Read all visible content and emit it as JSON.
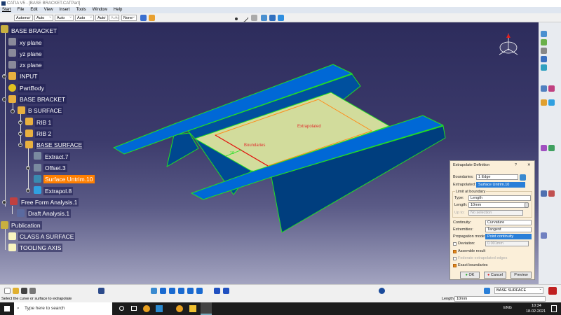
{
  "window": {
    "title": "CATIA V5 - [BASE BRACKET.CATPart]"
  },
  "menu": [
    "Start",
    "File",
    "Edit",
    "View",
    "Insert",
    "Tools",
    "Window",
    "Help"
  ],
  "toolbar_selects": [
    "Automa",
    "Auto",
    "Auto",
    "Auto",
    "Auto",
    "Auto",
    "None"
  ],
  "tree": {
    "root": "BASE BRACKET",
    "items": [
      "xy plane",
      "yz plane",
      "zx plane",
      "INPUT",
      "PartBody",
      "BASE BRACKET",
      "B SURFACE",
      "RIB 1",
      "RIB 2",
      "BASE SURFACE",
      "Extract.7",
      "Offset.3",
      "Surface Untrim.10",
      "Extrapol.8",
      "Free Form Analysis.1",
      "Draft Analysis.1",
      "Publication",
      "CLASS A SURFACE",
      "TOOLING AXIS"
    ],
    "selected": "Surface Untrim.10"
  },
  "model": {
    "labels": {
      "extrapolated": "Extrapolated",
      "boundaries": "Boundaries",
      "dimension": "10"
    },
    "colors": {
      "surface": "#0068d6",
      "edge": "#22e022",
      "plane": "#d2dc9c"
    }
  },
  "dialog": {
    "title": "Extrapolate Definition",
    "help": "?",
    "close": "✕",
    "boundaries_label": "Boundaries:",
    "boundaries_value": "1 Edge",
    "extrapolated_label": "Extrapolated:",
    "extrapolated_value": "Surface Untrim.10",
    "limit_group": "Limit at boundary",
    "type_label": "Type:",
    "type_value": "Length",
    "length_label": "Length:",
    "length_value": "10mm",
    "upto_label": "Up to:",
    "upto_value": "No selection",
    "continuity_label": "Continuity:",
    "continuity_value": "Curvature",
    "extremities_label": "Extremities:",
    "extremities_value": "Tangent",
    "propagation_label": "Propagation mode:",
    "propagation_value": "Point continuity",
    "deviation_label": "Deviation:",
    "deviation_value": "0.001mm",
    "assemble": {
      "label": "Assemble result",
      "checked": true
    },
    "federate": {
      "label": "Federate extrapolated edges",
      "checked": false
    },
    "exact": {
      "label": "Exact boundaries",
      "checked": true
    },
    "ok": "OK",
    "cancel": "Cancel",
    "preview": "Preview"
  },
  "bottom": {
    "select_value": "BASE SURFACE"
  },
  "status": {
    "message": "Select the curve or surface to extrapolate",
    "length_label": "Length",
    "length_value": "10mm"
  },
  "taskbar": {
    "search_placeholder": "Type here to search",
    "lang": "ENG",
    "time": "10:34",
    "date": "18-02-2021"
  }
}
